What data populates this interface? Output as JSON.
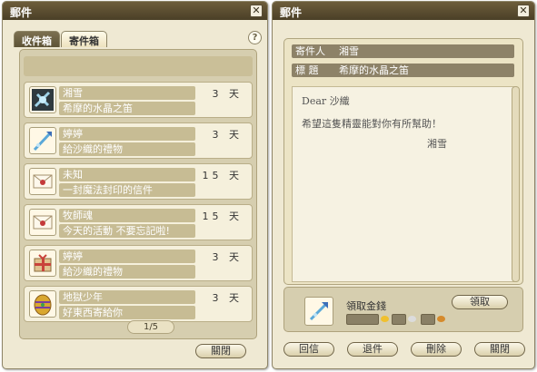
{
  "left": {
    "title": "郵件",
    "close_label": "✕",
    "tabs": [
      {
        "label": "收件箱",
        "active": false
      },
      {
        "label": "寄件箱",
        "active": true
      }
    ],
    "help_label": "?",
    "items": [
      {
        "sender": "湘雪",
        "subject": "希摩的水晶之笛",
        "days": "3 天",
        "icon": "crystal-flute-icon"
      },
      {
        "sender": "婷婷",
        "subject": "給沙織的禮物",
        "days": "3 天",
        "icon": "staff-item-icon"
      },
      {
        "sender": "未知",
        "subject": "一封魔法封印的信件",
        "days": "15 天",
        "icon": "sealed-letter-icon"
      },
      {
        "sender": "牧師魂",
        "subject": "今天的活動 不要忘記啦!",
        "days": "15 天",
        "icon": "sealed-letter-icon"
      },
      {
        "sender": "婷婷",
        "subject": "給沙織的禮物",
        "days": "3 天",
        "icon": "gift-box-icon"
      },
      {
        "sender": "地獄少年",
        "subject": "好東西寄給你",
        "days": "3 天",
        "icon": "easter-egg-icon"
      }
    ],
    "pager": "1/5",
    "close_button": "關閉"
  },
  "right": {
    "title": "郵件",
    "close_label": "✕",
    "sender_label": "寄件人",
    "sender_value": "湘雪",
    "subject_label": "標  題",
    "subject_value": "希摩的水晶之笛",
    "body_greeting": "Dear 沙織",
    "body_text": "希望這隻精靈能對你有所幫助！",
    "body_signature": "湘雪",
    "attachment_label": "領取金錢",
    "receive_button": "領取",
    "actions": [
      "回信",
      "退件",
      "刪除",
      "關閉"
    ]
  },
  "colors": {
    "window_bg": "#efe9d3",
    "titlebar": "#4a3f27",
    "row_field": "#c7bc94",
    "header_field": "#8d8268"
  }
}
